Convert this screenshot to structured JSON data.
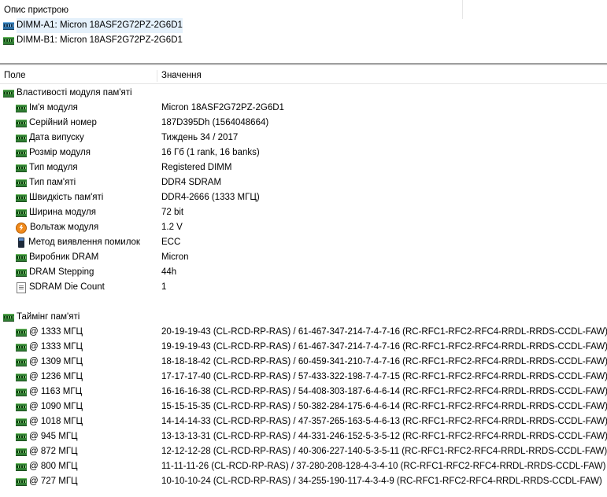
{
  "device_panel": {
    "header": "Опис пристрою",
    "items": [
      {
        "label": "DIMM-A1: Micron 18ASF2G72PZ-2G6D1",
        "icon": "ram-module-icon"
      },
      {
        "label": "DIMM-B1: Micron 18ASF2G72PZ-2G6D1",
        "icon": "ram-module-icon"
      }
    ]
  },
  "columns": {
    "field": "Поле",
    "value": "Значення"
  },
  "module_group": {
    "title": "Властивості модуля пам'яті",
    "rows": [
      {
        "field": "Ім'я модуля",
        "value": "Micron 18ASF2G72PZ-2G6D1",
        "icon": "ram"
      },
      {
        "field": "Серійний номер",
        "value": "187D395Dh (1564048664)",
        "icon": "ram"
      },
      {
        "field": "Дата випуску",
        "value": "Тиждень 34 / 2017",
        "icon": "ram"
      },
      {
        "field": "Розмір модуля",
        "value": "16 Гб (1 rank, 16 banks)",
        "icon": "ram"
      },
      {
        "field": "Тип модуля",
        "value": "Registered DIMM",
        "icon": "ram"
      },
      {
        "field": "Тип пам'яті",
        "value": "DDR4 SDRAM",
        "icon": "ram"
      },
      {
        "field": "Швидкість пам'яті",
        "value": "DDR4-2666 (1333 МГЦ)",
        "icon": "ram"
      },
      {
        "field": "Ширина модуля",
        "value": "72 bit",
        "icon": "ram"
      },
      {
        "field": "Вольтаж модуля",
        "value": "1.2 V",
        "icon": "volt"
      },
      {
        "field": "Метод виявлення помилок",
        "value": "ECC",
        "icon": "chip"
      },
      {
        "field": "Виробник DRAM",
        "value": "Micron",
        "icon": "ram"
      },
      {
        "field": "DRAM Stepping",
        "value": "44h",
        "icon": "ram"
      },
      {
        "field": "SDRAM Die Count",
        "value": "1",
        "icon": "doc"
      }
    ]
  },
  "timing_group": {
    "title": "Таймінг пам'яті",
    "rows": [
      {
        "field": "@ 1333 МГЦ",
        "value": "20-19-19-43  (CL-RCD-RP-RAS) / 61-467-347-214-7-4-7-16  (RC-RFC1-RFC2-RFC4-RRDL-RRDS-CCDL-FAW)"
      },
      {
        "field": "@ 1333 МГЦ",
        "value": "19-19-19-43  (CL-RCD-RP-RAS) / 61-467-347-214-7-4-7-16  (RC-RFC1-RFC2-RFC4-RRDL-RRDS-CCDL-FAW)"
      },
      {
        "field": "@ 1309 МГЦ",
        "value": "18-18-18-42  (CL-RCD-RP-RAS) / 60-459-341-210-7-4-7-16  (RC-RFC1-RFC2-RFC4-RRDL-RRDS-CCDL-FAW)"
      },
      {
        "field": "@ 1236 МГЦ",
        "value": "17-17-17-40  (CL-RCD-RP-RAS) / 57-433-322-198-7-4-7-15  (RC-RFC1-RFC2-RFC4-RRDL-RRDS-CCDL-FAW)"
      },
      {
        "field": "@ 1163 МГЦ",
        "value": "16-16-16-38  (CL-RCD-RP-RAS) / 54-408-303-187-6-4-6-14  (RC-RFC1-RFC2-RFC4-RRDL-RRDS-CCDL-FAW)"
      },
      {
        "field": "@ 1090 МГЦ",
        "value": "15-15-15-35  (CL-RCD-RP-RAS) / 50-382-284-175-6-4-6-14  (RC-RFC1-RFC2-RFC4-RRDL-RRDS-CCDL-FAW)"
      },
      {
        "field": "@ 1018 МГЦ",
        "value": "14-14-14-33  (CL-RCD-RP-RAS) / 47-357-265-163-5-4-6-13  (RC-RFC1-RFC2-RFC4-RRDL-RRDS-CCDL-FAW)"
      },
      {
        "field": "@ 945 МГЦ",
        "value": "13-13-13-31  (CL-RCD-RP-RAS) / 44-331-246-152-5-3-5-12  (RC-RFC1-RFC2-RFC4-RRDL-RRDS-CCDL-FAW)"
      },
      {
        "field": "@ 872 МГЦ",
        "value": "12-12-12-28  (CL-RCD-RP-RAS) / 40-306-227-140-5-3-5-11  (RC-RFC1-RFC2-RFC4-RRDL-RRDS-CCDL-FAW)"
      },
      {
        "field": "@ 800 МГЦ",
        "value": "11-11-11-26  (CL-RCD-RP-RAS) / 37-280-208-128-4-3-4-10  (RC-RFC1-RFC2-RFC4-RRDL-RRDS-CCDL-FAW)"
      },
      {
        "field": "@ 727 МГЦ",
        "value": "10-10-10-24  (CL-RCD-RP-RAS) / 34-255-190-117-4-3-4-9  (RC-RFC1-RFC2-RFC4-RRDL-RRDS-CCDL-FAW)"
      }
    ]
  }
}
